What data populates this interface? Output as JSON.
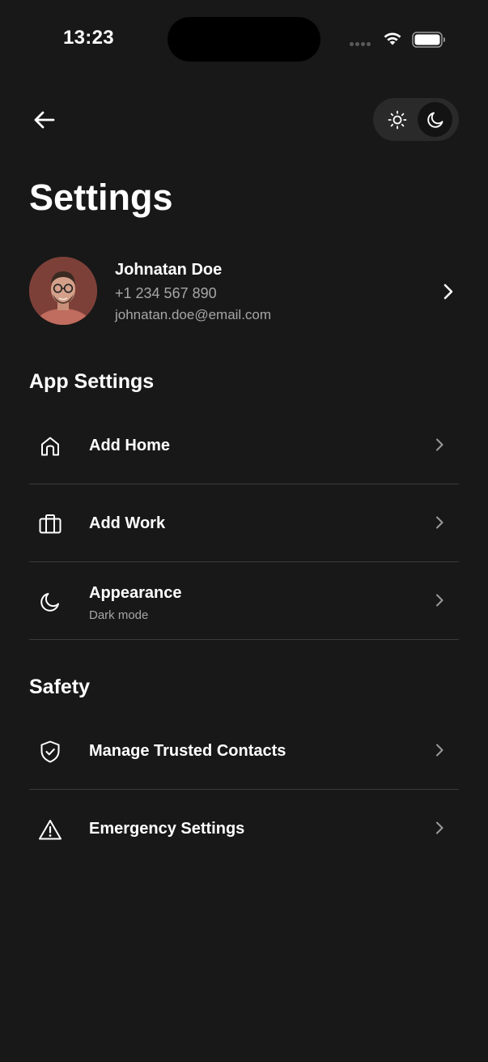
{
  "status_bar": {
    "time": "13:23"
  },
  "header": {
    "title": "Settings",
    "theme_toggle": {
      "selected": "dark"
    }
  },
  "profile": {
    "name": "Johnatan Doe",
    "phone": "+1 234 567 890",
    "email": "johnatan.doe@email.com"
  },
  "sections": [
    {
      "title": "App Settings",
      "items": [
        {
          "label": "Add Home",
          "icon": "home-icon"
        },
        {
          "label": "Add Work",
          "icon": "briefcase-icon"
        },
        {
          "label": "Appearance",
          "sublabel": "Dark mode",
          "icon": "moon-icon"
        }
      ]
    },
    {
      "title": "Safety",
      "items": [
        {
          "label": "Manage Trusted Contacts",
          "icon": "shield-check-icon"
        },
        {
          "label": "Emergency Settings",
          "icon": "warning-icon"
        }
      ]
    }
  ],
  "colors": {
    "background": "#181818",
    "text_primary": "#ffffff",
    "text_secondary": "#a6a6a6",
    "divider": "#3a3a3a",
    "toggle_track": "#2a2a2a"
  }
}
